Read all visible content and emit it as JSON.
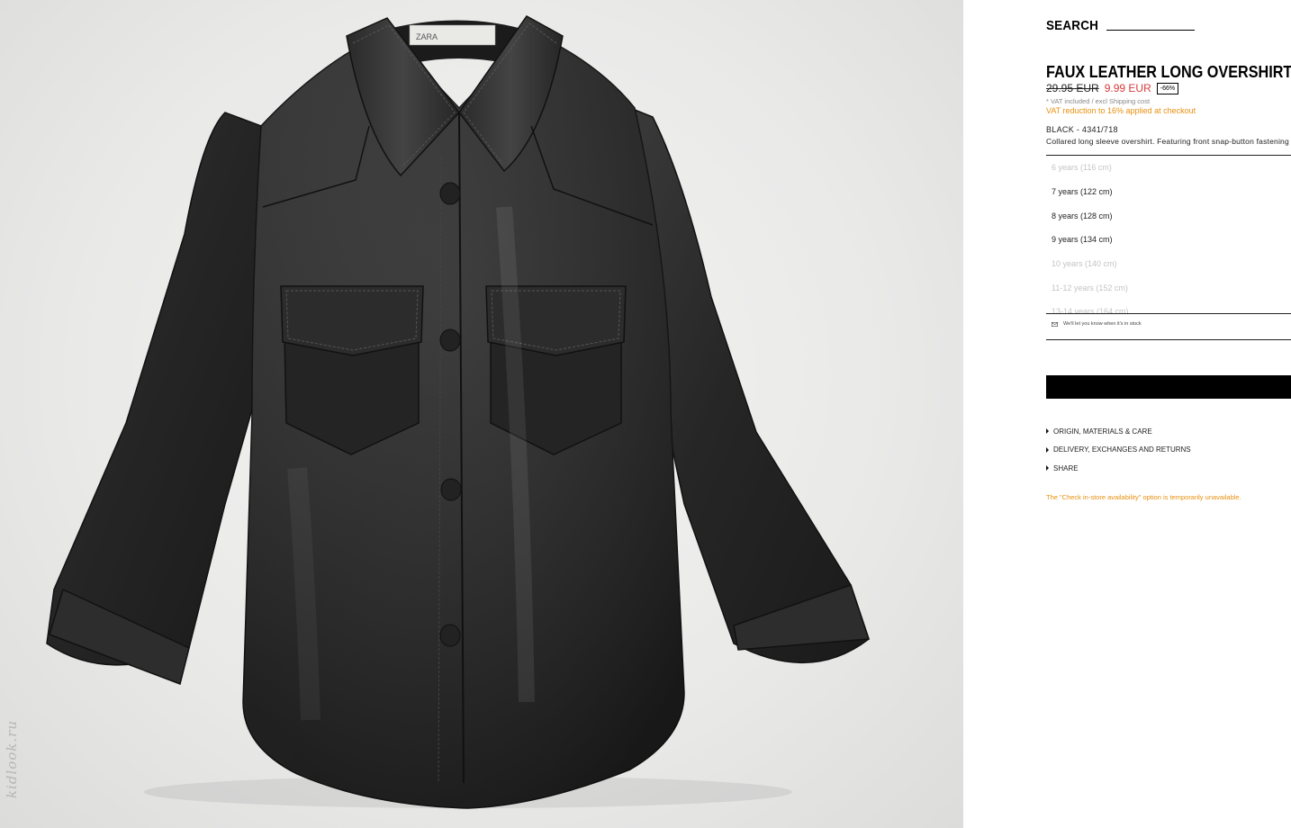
{
  "image": {
    "alt": "Black faux leather overshirt",
    "watermark": "kidlook.ru",
    "collar_label": "ZARA"
  },
  "header": {
    "search_label": "SEARCH"
  },
  "product": {
    "title": "FAUX LEATHER LONG OVERSHIRT",
    "price_old": "29.95 EUR",
    "price_new": "9.99 EUR",
    "discount": "-66%",
    "vat_note": "* VAT included / excl Shipping cost",
    "vat_reduction": "VAT reduction to 16% applied at checkout",
    "color_ref": "BLACK - 4341/718",
    "description": "Collared long sleeve overshirt. Featuring front snap-button fastening"
  },
  "sizes": [
    {
      "label": "6 years (116 cm)",
      "available": false
    },
    {
      "label": "7 years (122 cm)",
      "available": true
    },
    {
      "label": "8 years (128 cm)",
      "available": true
    },
    {
      "label": "9 years (134 cm)",
      "available": true
    },
    {
      "label": "10 years (140 cm)",
      "available": false
    },
    {
      "label": "11-12 years (152 cm)",
      "available": false
    },
    {
      "label": "13-14 years (164 cm)",
      "available": false
    }
  ],
  "notify": {
    "text": "We'll let you know when it's in stock",
    "icon": "mail-icon"
  },
  "add_button_label": "",
  "accordion": [
    {
      "label": "ORIGIN, MATERIALS & CARE"
    },
    {
      "label": "DELIVERY, EXCHANGES AND RETURNS"
    },
    {
      "label": "SHARE"
    }
  ],
  "store_note": "The \"Check in-store availability\" option is temporarily unavailable.",
  "colors": {
    "sale_price": "#d83b3b",
    "notice": "#e8900f",
    "button": "#000000"
  }
}
